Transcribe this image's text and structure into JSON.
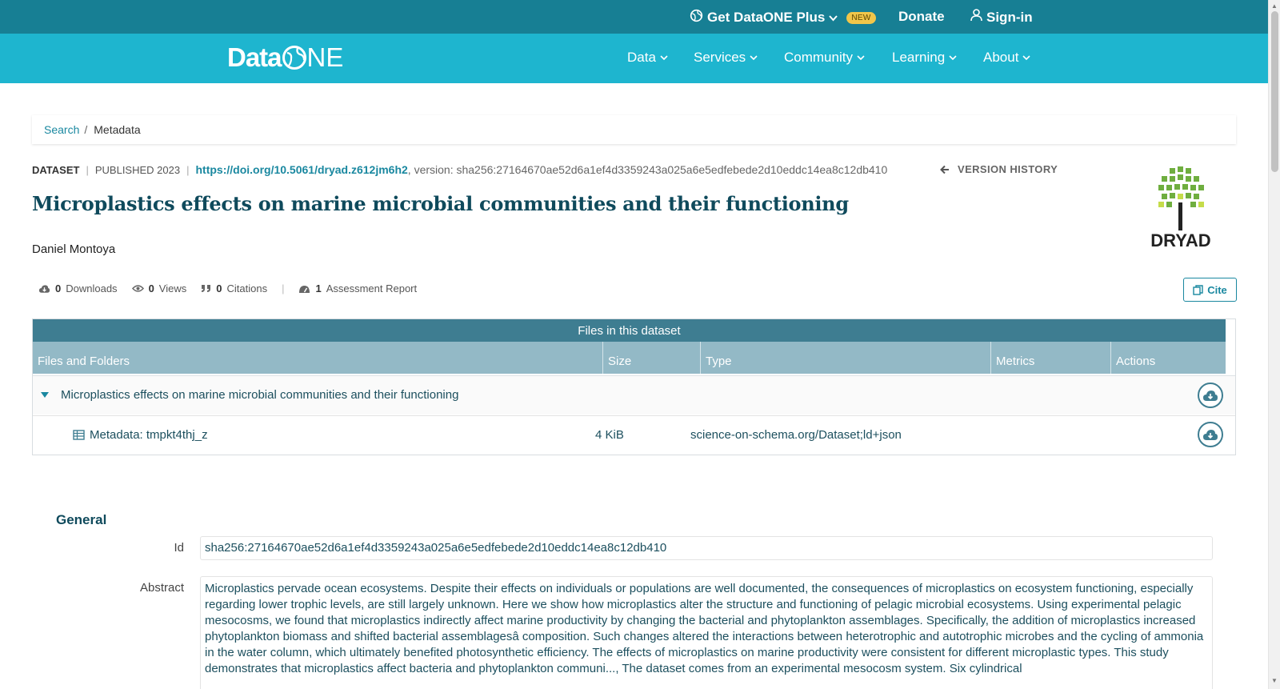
{
  "utility_bar": {
    "plus_label": "Get DataONE Plus",
    "new_badge": "NEW",
    "donate_label": "Donate",
    "signin_label": "Sign-in"
  },
  "navbar": {
    "logo_data": "Data",
    "logo_one_n": "NE",
    "items": [
      "Data",
      "Services",
      "Community",
      "Learning",
      "About"
    ]
  },
  "breadcrumb": {
    "search": "Search",
    "separator": "/",
    "current": "Metadata"
  },
  "dataset": {
    "type_label": "DATASET",
    "published": "PUBLISHED 2023",
    "doi": "https://doi.org/10.5061/dryad.z612jm6h2",
    "version": ", version: sha256:27164670ae52d6a1ef4d3359243a025a6e5edfebede2d10eddc14ea8c12db410",
    "version_history": "VERSION HISTORY",
    "title": "Microplastics effects on marine microbial communities and their functioning",
    "author": "Daniel Montoya",
    "repository_logo_text": "DRYAD"
  },
  "stats": {
    "downloads_count": "0",
    "downloads_label": "Downloads",
    "views_count": "0",
    "views_label": "Views",
    "citations_count": "0",
    "citations_label": "Citations",
    "assessment_count": "1",
    "assessment_label": "Assessment Report"
  },
  "cite_label": "Cite",
  "files": {
    "title": "Files in this dataset",
    "columns": [
      "Files and Folders",
      "Size",
      "Type",
      "Metrics",
      "Actions"
    ],
    "folder_name": "Microplastics effects on marine microbial communities and their functioning",
    "rows": [
      {
        "name": "Metadata: tmpkt4thj_z",
        "size": "4 KiB",
        "type": "science-on-schema.org/Dataset;ld+json"
      }
    ]
  },
  "general": {
    "heading": "General",
    "id_label": "Id",
    "id_value": "sha256:27164670ae52d6a1ef4d3359243a025a6e5edfebede2d10eddc14ea8c12db410",
    "abstract_label": "Abstract",
    "abstract_value": "Microplastics pervade ocean ecosystems. Despite their effects on individuals or populations are well documented, the consequences of microplastics on ecosystem functioning, especially regarding lower trophic levels, are still largely unknown. Here we show how microplastics alter the structure and functioning of pelagic microbial ecosystems. Using experimental pelagic mesocosms, we found that microplastics indirectly affect marine productivity by changing the bacterial and phytoplankton assemblages. Specifically, the addition of microplastics increased phytoplankton biomass and shifted bacterial assemblagesâ composition. Such changes altered the interactions between heterotrophic and autotrophic microbes and the cycling of ammonia in the water column, which ultimately benefited photosynthetic efficiency. The effects of microplastics on marine productivity were consistent for different microplastic types. This study demonstrates that microplastics affect bacteria and phytoplankton communi..., The dataset comes from an experimental mesocosm system. Six cylindrical"
  },
  "colors": {
    "utility_bar": "#177f94",
    "navbar": "#1eb5cf",
    "accent": "#1a88a0",
    "title": "#0f4a5c",
    "table_title": "#3e7d91",
    "table_header": "#93b9c6",
    "badge": "#f0c64a"
  },
  "icons": [
    "globe-icon",
    "chevron-down-icon",
    "user-icon",
    "arrow-left-icon",
    "cloud-download-icon",
    "eye-icon",
    "quote-icon",
    "gauge-icon",
    "copy-icon",
    "table-icon",
    "caret-down-icon"
  ]
}
